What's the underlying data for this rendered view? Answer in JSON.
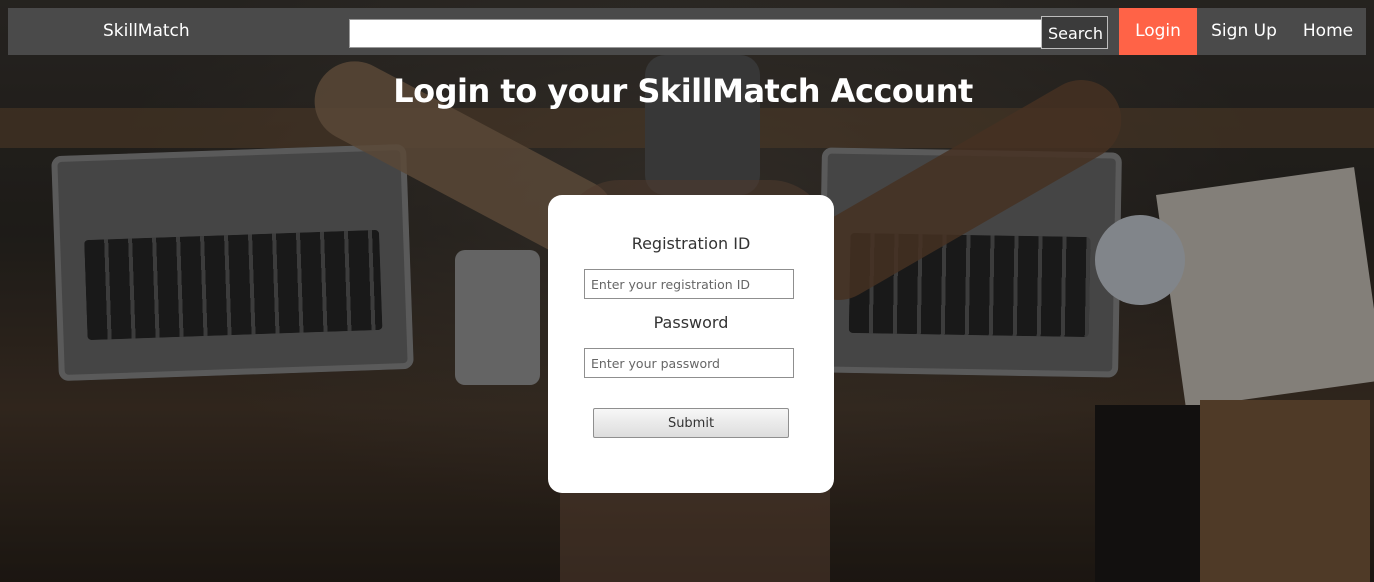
{
  "navbar": {
    "brand": "SkillMatch",
    "search_value": "",
    "search_button_label": "Search",
    "links": {
      "login": "Login",
      "signup": "Sign Up",
      "home": "Home"
    },
    "active_link": "Login",
    "accent_color": "#ff6347"
  },
  "main": {
    "title": "Login to your SkillMatch Account"
  },
  "login_form": {
    "registration_label": "Registration ID",
    "registration_placeholder": "Enter your registration ID",
    "registration_value": "",
    "password_label": "Password",
    "password_placeholder": "Enter your password",
    "password_value": "",
    "submit_label": "Submit"
  },
  "icons": {
    "background": "team-hands-over-desk-photo"
  }
}
